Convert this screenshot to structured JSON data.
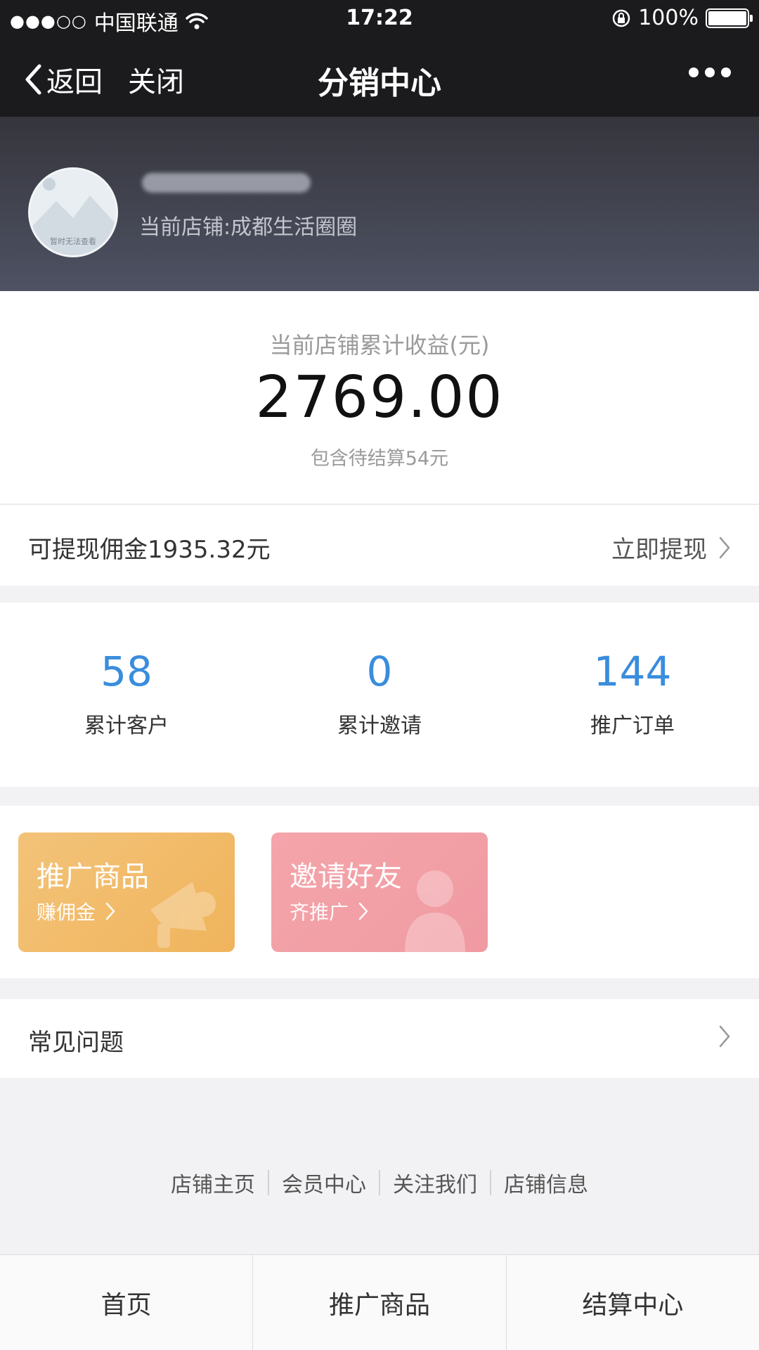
{
  "status_bar": {
    "carrier": "中国联通",
    "time": "17:22",
    "battery": "100%"
  },
  "nav": {
    "back_label": "返回",
    "close_label": "关闭",
    "title": "分销中心"
  },
  "profile": {
    "avatar_text": "暂时无法查看",
    "store_line": "当前店铺:成都生活圈圈"
  },
  "earnings": {
    "label": "当前店铺累计收益(元)",
    "value": "2769.00",
    "sub": "包含待结算54元"
  },
  "withdraw": {
    "text": "可提现佣金1935.32元",
    "link": "立即提现"
  },
  "stats": [
    {
      "value": "58",
      "label": "累计客户"
    },
    {
      "value": "0",
      "label": "累计邀请"
    },
    {
      "value": "144",
      "label": "推广订单"
    }
  ],
  "promos": [
    {
      "title": "推广商品",
      "sub": "赚佣金",
      "color": "#f2bb6a"
    },
    {
      "title": "邀请好友",
      "sub": "齐推广",
      "color": "#f2a0a6"
    }
  ],
  "faq": {
    "label": "常见问题"
  },
  "footer_links": [
    "店铺主页",
    "会员中心",
    "关注我们",
    "店铺信息"
  ],
  "tabs": [
    "首页",
    "推广商品",
    "结算中心"
  ],
  "colors": {
    "accent_blue": "#3a8ddd",
    "nav_bg": "#1b1b1d"
  }
}
